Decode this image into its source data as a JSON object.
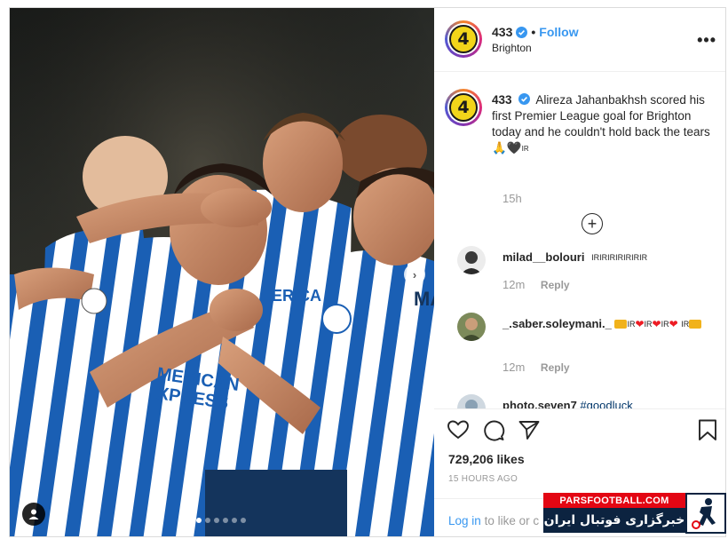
{
  "post": {
    "username": "433",
    "follow_label": "Follow",
    "location": "Brighton",
    "more_label": "•••",
    "avatar_text": "4"
  },
  "caption": {
    "username": "433",
    "text": "Alireza Jahanbakhsh scored his first Premier League goal for Brighton today and he couldn't hold back the tears 🙏🖤",
    "text_suffix": "IR",
    "time": "15h"
  },
  "load_more_label": "+",
  "comments": [
    {
      "username": "milad__bolouri",
      "text": "IRIRIRIRIRIRIR",
      "time": "12m",
      "reply_label": "Reply"
    },
    {
      "username": "_.saber.soleymani._",
      "text_parts": [
        "IR",
        "IR",
        "IR",
        "IR"
      ],
      "time": "12m",
      "reply_label": "Reply"
    },
    {
      "username": "photo.seven7",
      "text": "#goodluck"
    }
  ],
  "actions": {
    "like_icon": "heart-icon",
    "comment_icon": "comment-icon",
    "share_icon": "paper-plane-icon",
    "save_icon": "bookmark-icon"
  },
  "likes_label": "729,206 likes",
  "time_ago": "15 HOURS AGO",
  "login": {
    "link": "Log in",
    "text": "to like or c"
  },
  "watermark": {
    "site": "PARSFOOTBALL.COM",
    "tagline": "خبرگزاری فوتبال ایران"
  },
  "carousel": {
    "count": 6,
    "active_index": 0
  },
  "colors": {
    "accent": "#3897f0",
    "heart": "#ed1c24",
    "brighton_blue": "#1a5fb4",
    "avatar_yellow": "#f2d51a",
    "watermark_red": "#e30613",
    "watermark_navy": "#0c2340"
  }
}
